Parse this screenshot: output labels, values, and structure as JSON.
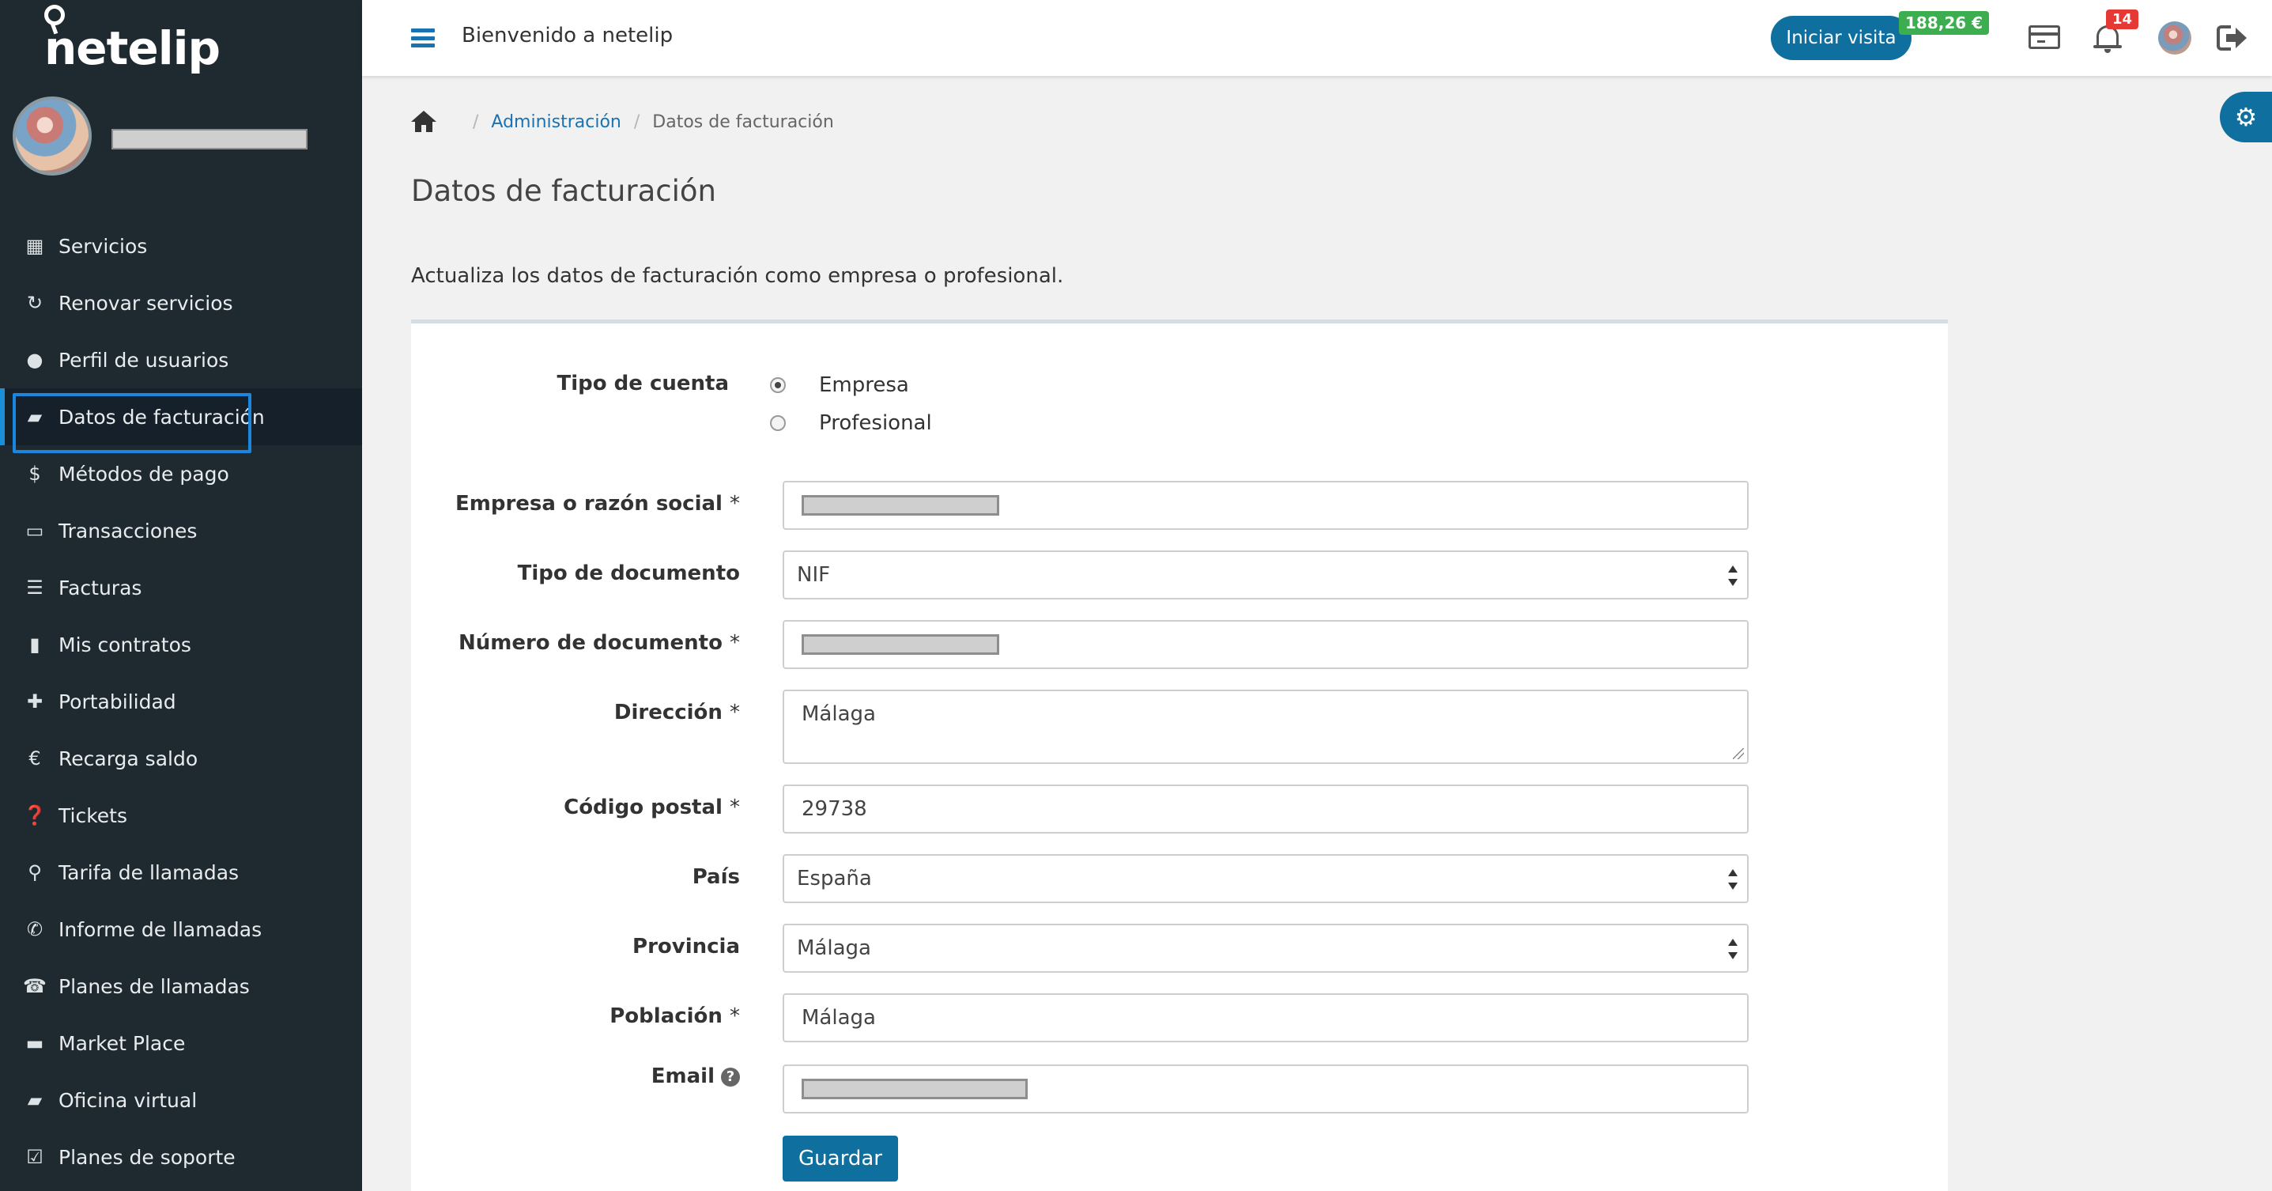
{
  "app": {
    "brand": "netelip",
    "welcome": "Bienvenido a netelip",
    "visit_button": "Iniciar visita",
    "balance": "188,26 €",
    "notification_count": "14"
  },
  "sidebar": {
    "items": [
      {
        "label": "Servicios",
        "icon": "grid-icon"
      },
      {
        "label": "Renovar servicios",
        "icon": "refresh-icon"
      },
      {
        "label": "Perfil de usuarios",
        "icon": "user-icon"
      },
      {
        "label": "Datos de facturación",
        "icon": "briefcase-icon",
        "active": true
      },
      {
        "label": "Métodos de pago",
        "icon": "dollar-icon"
      },
      {
        "label": "Transacciones",
        "icon": "credit-card-icon"
      },
      {
        "label": "Facturas",
        "icon": "list-icon"
      },
      {
        "label": "Mis contratos",
        "icon": "file-icon"
      },
      {
        "label": "Portabilidad",
        "icon": "plus-icon"
      },
      {
        "label": "Recarga saldo",
        "icon": "euro-icon"
      },
      {
        "label": "Tickets",
        "icon": "question-icon"
      },
      {
        "label": "Tarifa de llamadas",
        "icon": "search-icon"
      },
      {
        "label": "Informe de llamadas",
        "icon": "phone-icon"
      },
      {
        "label": "Planes de llamadas",
        "icon": "desk-phone-icon"
      },
      {
        "label": "Market Place",
        "icon": "monitor-icon"
      },
      {
        "label": "Oficina virtual",
        "icon": "briefcase-icon"
      },
      {
        "label": "Planes de soporte",
        "icon": "check-square-icon"
      }
    ]
  },
  "breadcrumb": {
    "link": "Administración",
    "current": "Datos de facturación"
  },
  "page": {
    "title": "Datos de facturación",
    "description": "Actualiza los datos de facturación como empresa o profesional."
  },
  "form": {
    "account_type": {
      "label": "Tipo de cuenta",
      "options": [
        "Empresa",
        "Profesional"
      ],
      "selected": "Empresa"
    },
    "company": {
      "label": "Empresa o razón social",
      "required": "*"
    },
    "document_type": {
      "label": "Tipo de documento",
      "value": "NIF"
    },
    "document_number": {
      "label": "Número de documento",
      "required": "*"
    },
    "address": {
      "label": "Dirección",
      "required": "*",
      "value": "Málaga"
    },
    "postal_code": {
      "label": "Código postal",
      "required": "*",
      "value": "29738"
    },
    "country": {
      "label": "País",
      "value": "España"
    },
    "province": {
      "label": "Provincia",
      "value": "Málaga"
    },
    "town": {
      "label": "Población",
      "required": "*",
      "value": "Málaga"
    },
    "email": {
      "label": "Email",
      "help": "?"
    },
    "save_label": "Guardar"
  },
  "colors": {
    "sidebar_bg": "#1f2a30",
    "accent": "#0f6f9f",
    "balance": "#3cae4f",
    "badge": "#e53935",
    "active_outline": "#1a86e0"
  }
}
